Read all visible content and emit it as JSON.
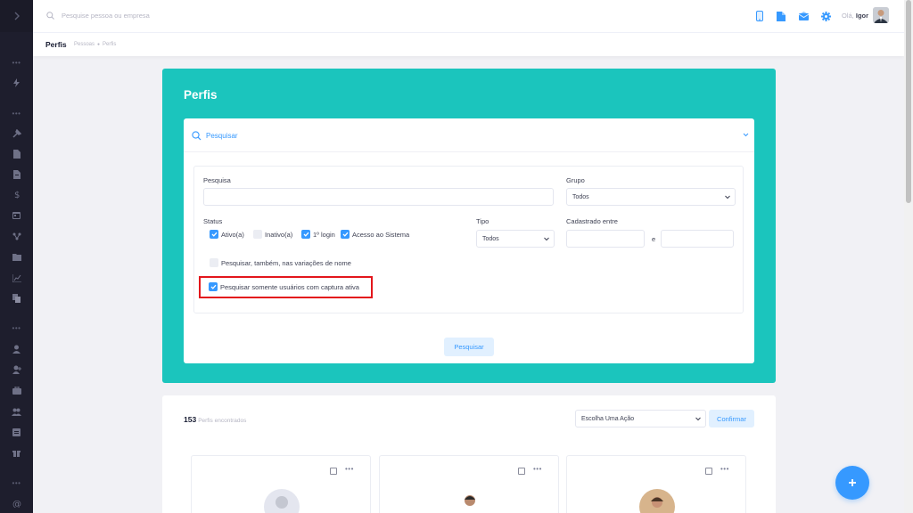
{
  "header": {
    "search_placeholder": "Pesquise pessoa ou empresa",
    "greeting_prefix": "Olá,",
    "greeting_name": "Igor"
  },
  "subheader": {
    "title": "Perfis",
    "breadcrumbs": [
      "Pessoas",
      "Perfis"
    ]
  },
  "main": {
    "title": "Perfis",
    "search_panel": {
      "toggle_label": "Pesquisar",
      "fields": {
        "pesquisa": {
          "label": "Pesquisa",
          "value": ""
        },
        "grupo": {
          "label": "Grupo",
          "value": "Todos"
        },
        "status": {
          "label": "Status"
        },
        "tipo": {
          "label": "Tipo",
          "value": "Todos"
        },
        "cadastrado": {
          "label": "Cadastrado entre",
          "separator": "e"
        }
      },
      "status_options": [
        {
          "label": "Ativo(a)",
          "checked": true
        },
        {
          "label": "Inativo(a)",
          "checked": false
        },
        {
          "label": "1º login",
          "checked": true
        },
        {
          "label": "Acesso ao Sistema",
          "checked": true
        }
      ],
      "variations_option": {
        "label": "Pesquisar, também, nas variações de nome",
        "checked": false
      },
      "capture_option": {
        "label": "Pesquisar somente usuários com captura ativa",
        "checked": true
      },
      "submit_label": "Pesquisar"
    },
    "results": {
      "count": "153",
      "count_label": "Perfis encontrados",
      "action_select": "Escolha Uma Ação",
      "confirm_label": "Confirmar"
    }
  },
  "colors": {
    "accent": "#3699ff",
    "teal": "#1bc5bd",
    "sidebar": "#1e1e2d",
    "highlight": "#e3161c"
  }
}
